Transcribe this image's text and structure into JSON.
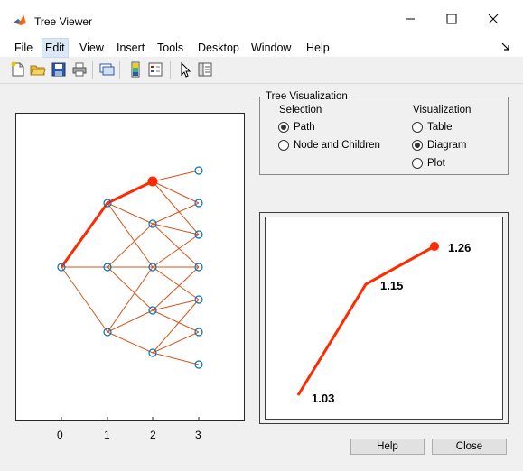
{
  "window": {
    "title": "Tree Viewer"
  },
  "menu": [
    "File",
    "Edit",
    "View",
    "Insert",
    "Tools",
    "Desktop",
    "Window",
    "Help"
  ],
  "group": {
    "title": "Tree Visualization",
    "selection_header": "Selection",
    "selection_options": [
      "Path",
      "Node and Children"
    ],
    "selection_value": "Path",
    "visualization_header": "Visualization",
    "visualization_options": [
      "Table",
      "Diagram",
      "Plot"
    ],
    "visualization_value": "Diagram"
  },
  "axes": {
    "x_ticks": [
      "0",
      "1",
      "2",
      "3"
    ]
  },
  "path_values": [
    "1.03",
    "1.15",
    "1.26"
  ],
  "buttons": {
    "help": "Help",
    "close": "Close"
  },
  "colors": {
    "tree_line": "#d95319",
    "path": "#ff2a00",
    "node": "#0072bd"
  }
}
